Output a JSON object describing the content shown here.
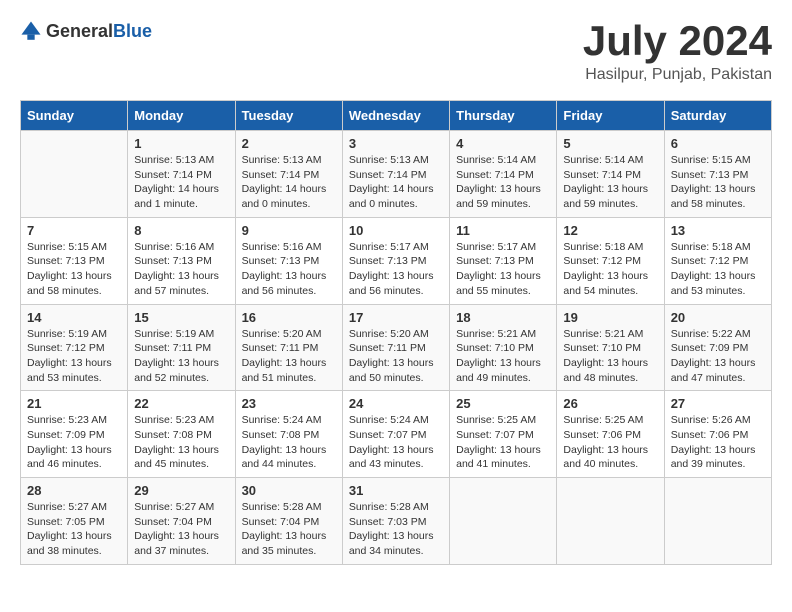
{
  "header": {
    "logo_general": "General",
    "logo_blue": "Blue",
    "month": "July 2024",
    "location": "Hasilpur, Punjab, Pakistan"
  },
  "columns": [
    "Sunday",
    "Monday",
    "Tuesday",
    "Wednesday",
    "Thursday",
    "Friday",
    "Saturday"
  ],
  "weeks": [
    [
      {
        "day": "",
        "sunrise": "",
        "sunset": "",
        "daylight": ""
      },
      {
        "day": "1",
        "sunrise": "Sunrise: 5:13 AM",
        "sunset": "Sunset: 7:14 PM",
        "daylight": "Daylight: 14 hours and 1 minute."
      },
      {
        "day": "2",
        "sunrise": "Sunrise: 5:13 AM",
        "sunset": "Sunset: 7:14 PM",
        "daylight": "Daylight: 14 hours and 0 minutes."
      },
      {
        "day": "3",
        "sunrise": "Sunrise: 5:13 AM",
        "sunset": "Sunset: 7:14 PM",
        "daylight": "Daylight: 14 hours and 0 minutes."
      },
      {
        "day": "4",
        "sunrise": "Sunrise: 5:14 AM",
        "sunset": "Sunset: 7:14 PM",
        "daylight": "Daylight: 13 hours and 59 minutes."
      },
      {
        "day": "5",
        "sunrise": "Sunrise: 5:14 AM",
        "sunset": "Sunset: 7:14 PM",
        "daylight": "Daylight: 13 hours and 59 minutes."
      },
      {
        "day": "6",
        "sunrise": "Sunrise: 5:15 AM",
        "sunset": "Sunset: 7:13 PM",
        "daylight": "Daylight: 13 hours and 58 minutes."
      }
    ],
    [
      {
        "day": "7",
        "sunrise": "Sunrise: 5:15 AM",
        "sunset": "Sunset: 7:13 PM",
        "daylight": "Daylight: 13 hours and 58 minutes."
      },
      {
        "day": "8",
        "sunrise": "Sunrise: 5:16 AM",
        "sunset": "Sunset: 7:13 PM",
        "daylight": "Daylight: 13 hours and 57 minutes."
      },
      {
        "day": "9",
        "sunrise": "Sunrise: 5:16 AM",
        "sunset": "Sunset: 7:13 PM",
        "daylight": "Daylight: 13 hours and 56 minutes."
      },
      {
        "day": "10",
        "sunrise": "Sunrise: 5:17 AM",
        "sunset": "Sunset: 7:13 PM",
        "daylight": "Daylight: 13 hours and 56 minutes."
      },
      {
        "day": "11",
        "sunrise": "Sunrise: 5:17 AM",
        "sunset": "Sunset: 7:13 PM",
        "daylight": "Daylight: 13 hours and 55 minutes."
      },
      {
        "day": "12",
        "sunrise": "Sunrise: 5:18 AM",
        "sunset": "Sunset: 7:12 PM",
        "daylight": "Daylight: 13 hours and 54 minutes."
      },
      {
        "day": "13",
        "sunrise": "Sunrise: 5:18 AM",
        "sunset": "Sunset: 7:12 PM",
        "daylight": "Daylight: 13 hours and 53 minutes."
      }
    ],
    [
      {
        "day": "14",
        "sunrise": "Sunrise: 5:19 AM",
        "sunset": "Sunset: 7:12 PM",
        "daylight": "Daylight: 13 hours and 53 minutes."
      },
      {
        "day": "15",
        "sunrise": "Sunrise: 5:19 AM",
        "sunset": "Sunset: 7:11 PM",
        "daylight": "Daylight: 13 hours and 52 minutes."
      },
      {
        "day": "16",
        "sunrise": "Sunrise: 5:20 AM",
        "sunset": "Sunset: 7:11 PM",
        "daylight": "Daylight: 13 hours and 51 minutes."
      },
      {
        "day": "17",
        "sunrise": "Sunrise: 5:20 AM",
        "sunset": "Sunset: 7:11 PM",
        "daylight": "Daylight: 13 hours and 50 minutes."
      },
      {
        "day": "18",
        "sunrise": "Sunrise: 5:21 AM",
        "sunset": "Sunset: 7:10 PM",
        "daylight": "Daylight: 13 hours and 49 minutes."
      },
      {
        "day": "19",
        "sunrise": "Sunrise: 5:21 AM",
        "sunset": "Sunset: 7:10 PM",
        "daylight": "Daylight: 13 hours and 48 minutes."
      },
      {
        "day": "20",
        "sunrise": "Sunrise: 5:22 AM",
        "sunset": "Sunset: 7:09 PM",
        "daylight": "Daylight: 13 hours and 47 minutes."
      }
    ],
    [
      {
        "day": "21",
        "sunrise": "Sunrise: 5:23 AM",
        "sunset": "Sunset: 7:09 PM",
        "daylight": "Daylight: 13 hours and 46 minutes."
      },
      {
        "day": "22",
        "sunrise": "Sunrise: 5:23 AM",
        "sunset": "Sunset: 7:08 PM",
        "daylight": "Daylight: 13 hours and 45 minutes."
      },
      {
        "day": "23",
        "sunrise": "Sunrise: 5:24 AM",
        "sunset": "Sunset: 7:08 PM",
        "daylight": "Daylight: 13 hours and 44 minutes."
      },
      {
        "day": "24",
        "sunrise": "Sunrise: 5:24 AM",
        "sunset": "Sunset: 7:07 PM",
        "daylight": "Daylight: 13 hours and 43 minutes."
      },
      {
        "day": "25",
        "sunrise": "Sunrise: 5:25 AM",
        "sunset": "Sunset: 7:07 PM",
        "daylight": "Daylight: 13 hours and 41 minutes."
      },
      {
        "day": "26",
        "sunrise": "Sunrise: 5:25 AM",
        "sunset": "Sunset: 7:06 PM",
        "daylight": "Daylight: 13 hours and 40 minutes."
      },
      {
        "day": "27",
        "sunrise": "Sunrise: 5:26 AM",
        "sunset": "Sunset: 7:06 PM",
        "daylight": "Daylight: 13 hours and 39 minutes."
      }
    ],
    [
      {
        "day": "28",
        "sunrise": "Sunrise: 5:27 AM",
        "sunset": "Sunset: 7:05 PM",
        "daylight": "Daylight: 13 hours and 38 minutes."
      },
      {
        "day": "29",
        "sunrise": "Sunrise: 5:27 AM",
        "sunset": "Sunset: 7:04 PM",
        "daylight": "Daylight: 13 hours and 37 minutes."
      },
      {
        "day": "30",
        "sunrise": "Sunrise: 5:28 AM",
        "sunset": "Sunset: 7:04 PM",
        "daylight": "Daylight: 13 hours and 35 minutes."
      },
      {
        "day": "31",
        "sunrise": "Sunrise: 5:28 AM",
        "sunset": "Sunset: 7:03 PM",
        "daylight": "Daylight: 13 hours and 34 minutes."
      },
      {
        "day": "",
        "sunrise": "",
        "sunset": "",
        "daylight": ""
      },
      {
        "day": "",
        "sunrise": "",
        "sunset": "",
        "daylight": ""
      },
      {
        "day": "",
        "sunrise": "",
        "sunset": "",
        "daylight": ""
      }
    ]
  ]
}
